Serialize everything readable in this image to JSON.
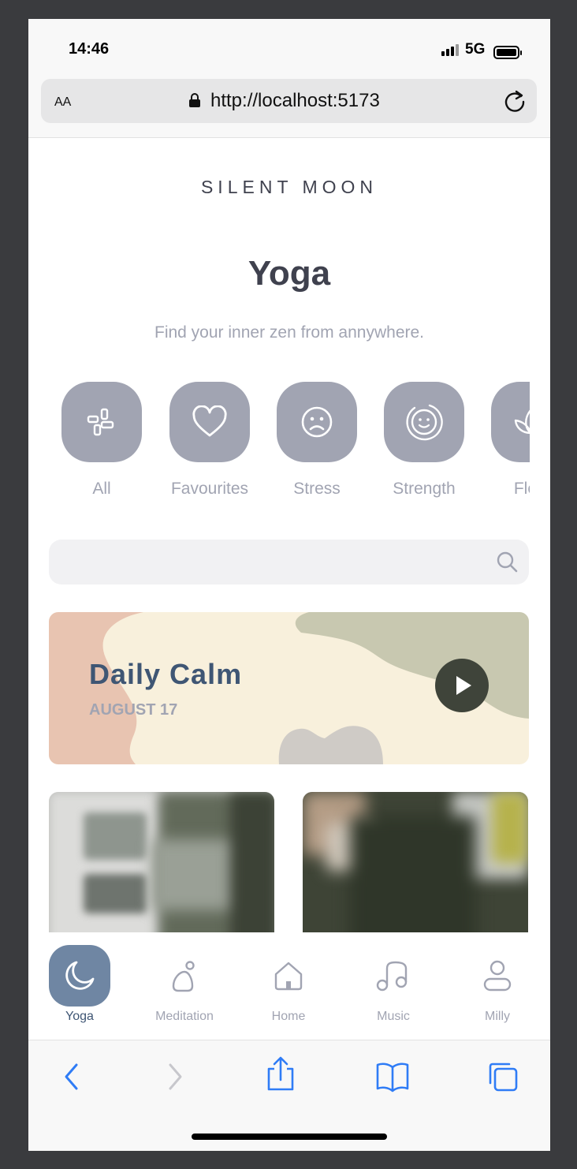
{
  "status_bar": {
    "time": "14:46",
    "network": "5G"
  },
  "browser": {
    "text_size_label": "AA",
    "url": "http://localhost:5173"
  },
  "app": {
    "brand": "SILENT  MOON",
    "title": "Yoga",
    "subtitle": "Find your inner zen from annywhere."
  },
  "categories": [
    {
      "label": "All",
      "icon": "grid-icon"
    },
    {
      "label": "Favourites",
      "icon": "heart-icon"
    },
    {
      "label": "Stress",
      "icon": "sad-face-icon"
    },
    {
      "label": "Strength",
      "icon": "smile-circle-icon"
    },
    {
      "label": "Flexi",
      "icon": "lotus-icon"
    }
  ],
  "search": {
    "placeholder": ""
  },
  "banner": {
    "title": "Daily Calm",
    "date": "AUGUST 17"
  },
  "tabbar": {
    "items": [
      {
        "label": "Yoga",
        "icon": "moon-icon",
        "active": true
      },
      {
        "label": "Meditation",
        "icon": "meditation-icon",
        "active": false
      },
      {
        "label": "Home",
        "icon": "home-icon",
        "active": false
      },
      {
        "label": "Music",
        "icon": "music-icon",
        "active": false
      },
      {
        "label": "Milly",
        "icon": "profile-icon",
        "active": false
      }
    ]
  },
  "colors": {
    "accent": "#6f86a3",
    "text_dark": "#3f414e",
    "text_muted": "#a1a4b2",
    "banner_title": "#3f5674",
    "ios_blue": "#2f7cf6"
  }
}
